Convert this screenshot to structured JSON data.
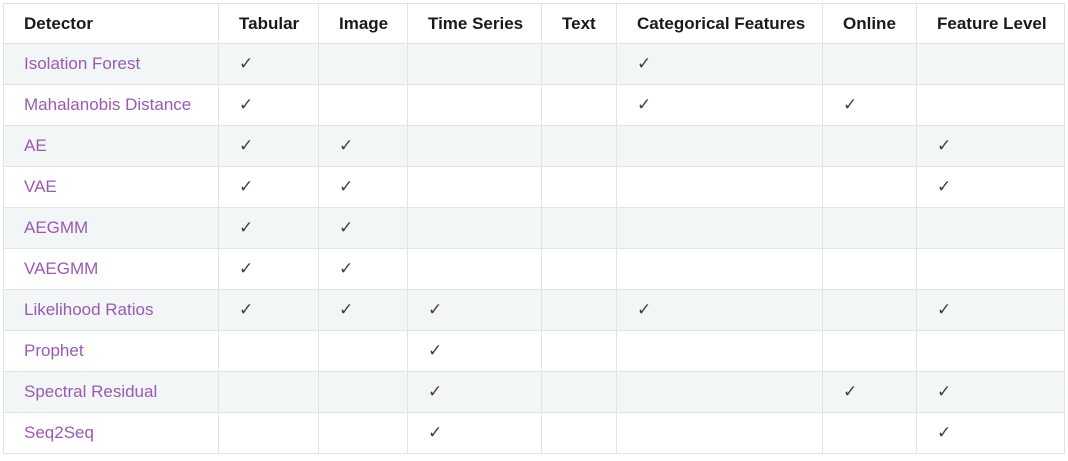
{
  "table": {
    "check_glyph": "✓",
    "headers": [
      "Detector",
      "Tabular",
      "Image",
      "Time Series",
      "Text",
      "Categorical Features",
      "Online",
      "Feature Level"
    ],
    "rows": [
      {
        "name": "Isolation Forest",
        "tabular": "✓",
        "image": "",
        "time_series": "",
        "text": "",
        "categorical": "✓",
        "online": "",
        "feature_level": ""
      },
      {
        "name": "Mahalanobis Distance",
        "tabular": "✓",
        "image": "",
        "time_series": "",
        "text": "",
        "categorical": "✓",
        "online": "✓",
        "feature_level": ""
      },
      {
        "name": "AE",
        "tabular": "✓",
        "image": "✓",
        "time_series": "",
        "text": "",
        "categorical": "",
        "online": "",
        "feature_level": "✓"
      },
      {
        "name": "VAE",
        "tabular": "✓",
        "image": "✓",
        "time_series": "",
        "text": "",
        "categorical": "",
        "online": "",
        "feature_level": "✓"
      },
      {
        "name": "AEGMM",
        "tabular": "✓",
        "image": "✓",
        "time_series": "",
        "text": "",
        "categorical": "",
        "online": "",
        "feature_level": ""
      },
      {
        "name": "VAEGMM",
        "tabular": "✓",
        "image": "✓",
        "time_series": "",
        "text": "",
        "categorical": "",
        "online": "",
        "feature_level": ""
      },
      {
        "name": "Likelihood Ratios",
        "tabular": "✓",
        "image": "✓",
        "time_series": "✓",
        "text": "",
        "categorical": "✓",
        "online": "",
        "feature_level": "✓"
      },
      {
        "name": "Prophet",
        "tabular": "",
        "image": "",
        "time_series": "✓",
        "text": "",
        "categorical": "",
        "online": "",
        "feature_level": ""
      },
      {
        "name": "Spectral Residual",
        "tabular": "",
        "image": "",
        "time_series": "✓",
        "text": "",
        "categorical": "",
        "online": "✓",
        "feature_level": "✓"
      },
      {
        "name": "Seq2Seq",
        "tabular": "",
        "image": "",
        "time_series": "✓",
        "text": "",
        "categorical": "",
        "online": "",
        "feature_level": "✓"
      }
    ]
  },
  "colors": {
    "link": "#9b59b6",
    "stripe": "#f3f6f6",
    "border": "#e1e4e5",
    "text": "#404040"
  }
}
